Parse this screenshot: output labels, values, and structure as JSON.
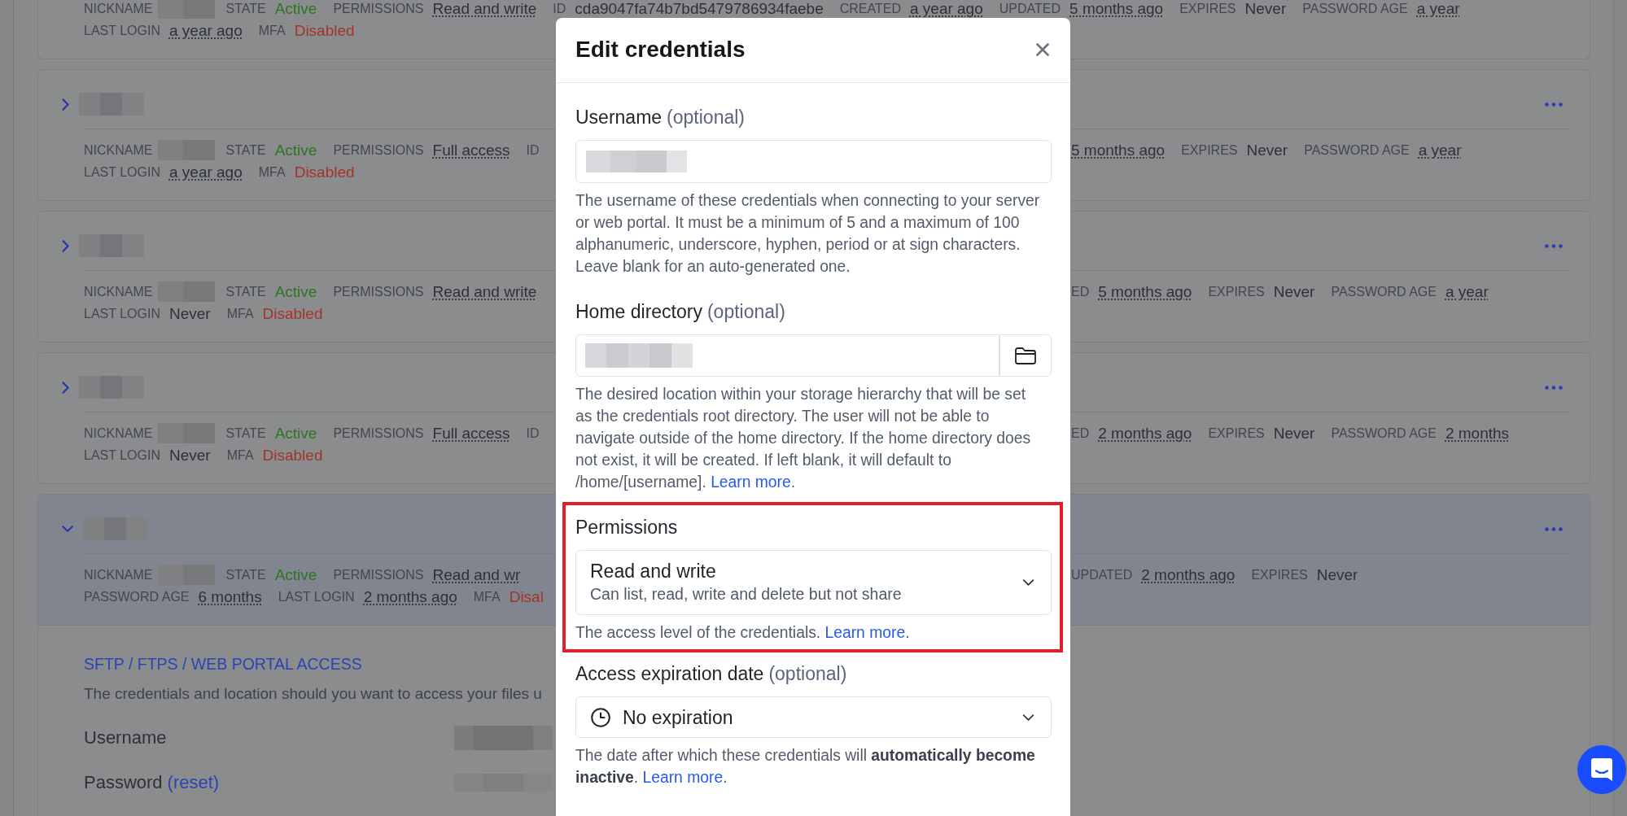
{
  "credentials": [
    {
      "lines": [
        {
          "items": [
            {
              "label": "NICKNAME",
              "kind": "redacted"
            },
            {
              "label": "STATE",
              "value": "Active",
              "kind": "positive"
            },
            {
              "label": "PERMISSIONS",
              "value": "Read and write",
              "kind": "dotted"
            },
            {
              "label": "ID",
              "value": "cda9047fa74b7bd5479786934faebe",
              "kind": "plain"
            },
            {
              "label": "CREATED",
              "value": "a year ago",
              "kind": "dotted"
            },
            {
              "label": "UPDATED",
              "value": "5 months ago",
              "kind": "dotted"
            },
            {
              "label": "EXPIRES",
              "value": "Never",
              "kind": "plain"
            },
            {
              "label": "PASSWORD AGE",
              "value": "a year",
              "kind": "dotted"
            }
          ]
        },
        {
          "items": [
            {
              "label": "LAST LOGIN",
              "value": "a year ago",
              "kind": "dotted"
            },
            {
              "label": "MFA",
              "value": "Disabled",
              "kind": "negative"
            }
          ]
        }
      ]
    },
    {
      "header": {
        "expanded": false
      },
      "lines": [
        {
          "left": [
            {
              "label": "NICKNAME",
              "kind": "redacted"
            },
            {
              "label": "STATE",
              "value": "Active",
              "kind": "positive"
            },
            {
              "label": "PERMISSIONS",
              "value": "Full access",
              "kind": "dotted"
            },
            {
              "label": "ID"
            }
          ],
          "right": [
            {
              "value": "5 months ago",
              "kind": "dotted"
            },
            {
              "label": "EXPIRES",
              "value": "Never",
              "kind": "plain"
            },
            {
              "label": "PASSWORD AGE",
              "value": "a year",
              "kind": "dotted"
            }
          ]
        },
        {
          "items": [
            {
              "label": "LAST LOGIN",
              "value": "a year ago",
              "kind": "dotted"
            },
            {
              "label": "MFA",
              "value": "Disabled",
              "kind": "negative"
            }
          ]
        }
      ]
    },
    {
      "header": {
        "expanded": false
      },
      "lines": [
        {
          "left": [
            {
              "label": "NICKNAME",
              "kind": "redacted"
            },
            {
              "label": "STATE",
              "value": "Active",
              "kind": "positive"
            },
            {
              "label": "PERMISSIONS",
              "value": "Read and write",
              "kind": "dotted"
            }
          ],
          "right": [
            {
              "label": "ED",
              "value": "5 months ago",
              "kind": "dotted"
            },
            {
              "label": "EXPIRES",
              "value": "Never",
              "kind": "plain"
            },
            {
              "label": "PASSWORD AGE",
              "value": "a year",
              "kind": "dotted"
            }
          ]
        },
        {
          "items": [
            {
              "label": "LAST LOGIN",
              "value": "Never",
              "kind": "plain"
            },
            {
              "label": "MFA",
              "value": "Disabled",
              "kind": "negative"
            }
          ]
        }
      ]
    },
    {
      "header": {
        "expanded": false
      },
      "lines": [
        {
          "left": [
            {
              "label": "NICKNAME",
              "kind": "redacted"
            },
            {
              "label": "STATE",
              "value": "Active",
              "kind": "positive"
            },
            {
              "label": "PERMISSIONS",
              "value": "Full access",
              "kind": "dotted"
            },
            {
              "label": "ID"
            }
          ],
          "right": [
            {
              "label": "ED",
              "value": "2 months ago",
              "kind": "dotted"
            },
            {
              "label": "EXPIRES",
              "value": "Never",
              "kind": "plain"
            },
            {
              "label": "PASSWORD AGE",
              "value": "2 months",
              "kind": "dotted"
            }
          ]
        },
        {
          "items": [
            {
              "label": "LAST LOGIN",
              "value": "Never",
              "kind": "plain"
            },
            {
              "label": "MFA",
              "value": "Disabled",
              "kind": "negative"
            }
          ]
        }
      ]
    },
    {
      "header": {
        "expanded": true
      },
      "lines": [
        {
          "left": [
            {
              "label": "NICKNAME",
              "kind": "redacted"
            },
            {
              "label": "STATE",
              "value": "Active",
              "kind": "positive"
            },
            {
              "label": "PERMISSIONS",
              "value": "Read and wr",
              "kind": "dotted"
            }
          ],
          "right": [
            {
              "label": "UPDATED",
              "value": "2 months ago",
              "kind": "dotted"
            },
            {
              "label": "EXPIRES",
              "value": "Never",
              "kind": "plain"
            }
          ]
        },
        {
          "left": [
            {
              "label": "PASSWORD AGE",
              "value": "6 months",
              "kind": "dotted"
            },
            {
              "label": "LAST LOGIN",
              "value": "2 months ago",
              "kind": "dotted"
            },
            {
              "label": "MFA",
              "value": "Disal",
              "kind": "negative"
            }
          ]
        }
      ],
      "details": {
        "title": "SFTP / FTPS / WEB PORTAL ACCESS",
        "description": "The credentials and location should you want to access your files u",
        "fields": [
          {
            "label": "Username",
            "value_blurred": true
          },
          {
            "label": "Password",
            "link": "(reset)",
            "value_blurred": true
          }
        ]
      }
    }
  ],
  "modal": {
    "title": "Edit credentials",
    "fields": [
      {
        "kind": "text",
        "label": "Username",
        "hint": "(optional)",
        "value_blurred": true,
        "help": "The username of these credentials when connecting to your server or web portal. It must be a minimum of 5 and a maximum of 100 alphanumeric, underscore, hyphen, period or at sign characters. Leave blank for an auto-generated one.",
        "highlighted": false
      },
      {
        "kind": "folder",
        "label": "Home directory",
        "hint": "(optional)",
        "value_blurred": true,
        "help": "The desired location within your storage hierarchy that will be set as the credentials root directory. The user will not be able to navigate outside of the home directory. If the home directory does not exist, it will be created. If left blank, it will default to /home/[username].",
        "link": "Learn more",
        "tail": ".",
        "highlighted": false
      },
      {
        "kind": "select",
        "label": "Permissions",
        "value": "Read and write",
        "description": "Can list, read, write and delete but not share",
        "help": "The access level of the credentials.",
        "link": "Learn more",
        "tail": ".",
        "highlighted": true
      },
      {
        "kind": "date",
        "label": "Access expiration date",
        "hint": "(optional)",
        "value": "No expiration",
        "help": "The date after which these credentials will **automatically become inactive**.",
        "link": "Learn more",
        "tail": ".",
        "highlighted": false
      }
    ]
  }
}
